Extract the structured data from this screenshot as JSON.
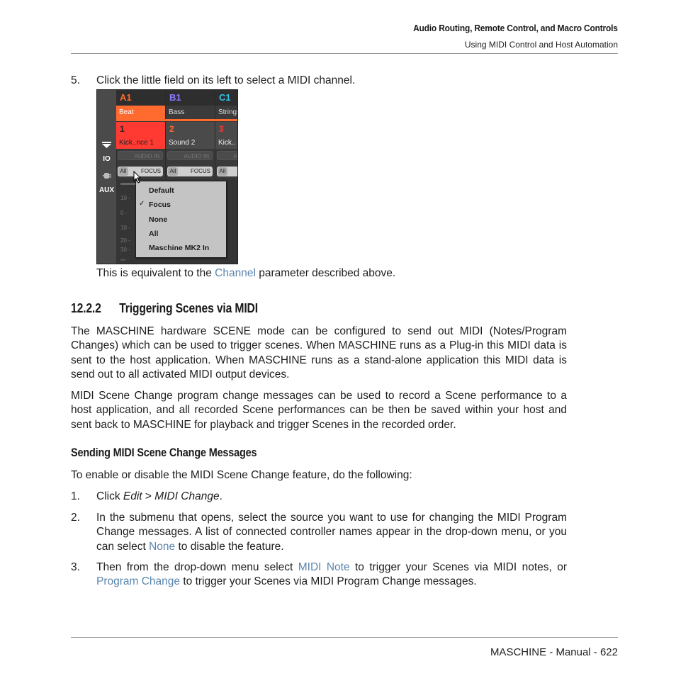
{
  "header": {
    "chapter_title": "Audio Routing, Remote Control, and Macro Controls",
    "section_title": "Using MIDI Control and Host Automation"
  },
  "step5": {
    "number": "5.",
    "text": "Click the little field on its left to select a MIDI channel."
  },
  "screenshot": {
    "sidebar_labels": [
      "IO",
      "AUX"
    ],
    "groups": [
      {
        "id": "A1",
        "name": "Beat",
        "color": "#ff6a2e",
        "selected": true
      },
      {
        "id": "B1",
        "name": "Bass",
        "color": "#8a7cff",
        "selected": false
      },
      {
        "id": "C1",
        "name": "Strings",
        "color": "#2fc4e8",
        "selected": false
      }
    ],
    "sounds": [
      {
        "number": "1",
        "name": "Kick..nce 1",
        "selected": true
      },
      {
        "number": "2",
        "name": "Sound 2",
        "selected": false
      },
      {
        "number": "3",
        "name": "Kick..",
        "selected": false
      }
    ],
    "audio_in_label": "AUDIO IN",
    "channel_all_label": "All",
    "channel_focus_label": "FOCUS",
    "meter_ticks": [
      "10 -",
      "0 -",
      "10 -",
      "20 -",
      "30 -",
      "∞-"
    ],
    "dropdown": {
      "items": [
        {
          "label": "Default",
          "checked": false
        },
        {
          "label": "Focus",
          "checked": true
        },
        {
          "label": "None",
          "checked": false
        },
        {
          "label": "All",
          "checked": false
        },
        {
          "label": "Maschine MK2 In",
          "checked": false
        }
      ],
      "check_glyph": "✓"
    }
  },
  "caption": {
    "before": "This is equivalent to the ",
    "link": "Channel",
    "after": " parameter described above."
  },
  "section": {
    "number": "12.2.2",
    "title": "Triggering Scenes via MIDI"
  },
  "paragraphs": [
    "The MASCHINE hardware SCENE mode can be configured to send out MIDI (Notes/Program Changes) which can be used to trigger scenes. When MASCHINE runs as a Plug-in this MIDI data is sent to the host application. When MASCHINE runs as a stand-alone application this MIDI data is send out to all activated MIDI output devices.",
    "MIDI Scene Change program change messages can be used to record a Scene performance to a host application, and all recorded Scene performances can be then be saved within your host and sent back to MASCHINE for playback and trigger Scenes in the recorded order."
  ],
  "subsection": {
    "title": "Sending MIDI Scene Change Messages",
    "intro": "To enable or disable the MIDI Scene Change feature, do the following:"
  },
  "steps": [
    {
      "number": "1.",
      "pre": "Click ",
      "em1": "Edit",
      "mid": " > ",
      "em2": "MIDI Change",
      "post": "."
    },
    {
      "number": "2.",
      "text": "In the submenu that opens, select the source you want to use for changing the MIDI Program Change messages. A list of connected controller names appear in the drop-down menu, or you can select ",
      "link": "None",
      "after": " to disable the feature."
    },
    {
      "number": "3.",
      "pre": "Then from the drop-down menu select ",
      "link1": "MIDI Note",
      "mid": " to trigger your Scenes via MIDI notes, or ",
      "link2": "Program Change",
      "post": " to trigger your Scenes via MIDI Program Change messages."
    }
  ],
  "footer": {
    "text": "MASCHINE - Manual - 622"
  }
}
